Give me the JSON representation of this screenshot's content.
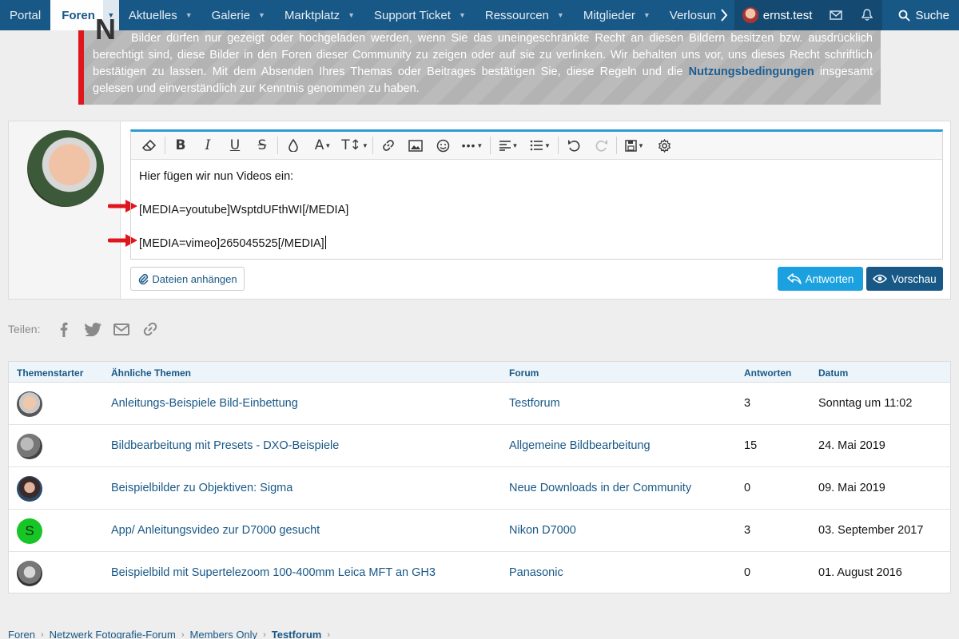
{
  "nav": {
    "items": [
      {
        "label": "Portal"
      },
      {
        "label": "Foren"
      },
      {
        "label": "Aktuelles"
      },
      {
        "label": "Galerie"
      },
      {
        "label": "Marktplatz"
      },
      {
        "label": "Support Ticket"
      },
      {
        "label": "Ressourcen"
      },
      {
        "label": "Mitglieder"
      },
      {
        "label": "Verlosungen"
      }
    ],
    "user": "ernst.test",
    "search": "Suche"
  },
  "notice": {
    "text": "Bilder dürfen nur gezeigt oder hochgeladen werden, wenn Sie das uneingeschränkte Recht an diesen Bildern besitzen bzw. ausdrücklich berechtigt sind, diese Bilder in den Foren dieser Community zu zeigen oder auf sie zu verlinken. Wir behalten uns vor, uns dieses Recht schriftlich bestätigen zu lassen. Mit dem Absenden Ihres Themas oder Beitrages bestätigen Sie, diese Regeln und die ",
    "link": "Nutzungsbedingungen",
    "tail": " insgesamt gelesen und einverständlich zur Kenntnis genommen zu haben."
  },
  "editor": {
    "lines": [
      "Hier fügen wir nun Videos ein:",
      "[MEDIA=youtube]WsptdUFthWI[/MEDIA]",
      "[MEDIA=vimeo]265045525[/MEDIA]"
    ],
    "attach_label": "Dateien anhängen",
    "reply_label": "Antworten",
    "preview_label": "Vorschau"
  },
  "share": {
    "label": "Teilen:"
  },
  "similar": {
    "headers": {
      "starter": "Themenstarter",
      "title": "Ähnliche Themen",
      "forum": "Forum",
      "replies": "Antworten",
      "date": "Datum"
    },
    "rows": [
      {
        "title": "Anleitungs-Beispiele Bild-Einbettung",
        "forum": "Testforum",
        "replies": "3",
        "date": "Sonntag um 11:02",
        "avatar_letter": ""
      },
      {
        "title": "Bildbearbeitung mit Presets - DXO-Beispiele",
        "forum": "Allgemeine Bildbearbeitung",
        "replies": "15",
        "date": "24. Mai 2019",
        "avatar_letter": ""
      },
      {
        "title": "Beispielbilder zu Objektiven: Sigma",
        "forum": "Neue Downloads in der Community",
        "replies": "0",
        "date": "09. Mai 2019",
        "avatar_letter": ""
      },
      {
        "title": "App/ Anleitungsvideo zur D7000 gesucht",
        "forum": "Nikon D7000",
        "replies": "3",
        "date": "03. September 2017",
        "avatar_letter": "S"
      },
      {
        "title": "Beispielbild mit Supertelezoom 100-400mm Leica MFT an GH3",
        "forum": "Panasonic",
        "replies": "0",
        "date": "01. August 2016",
        "avatar_letter": ""
      }
    ]
  },
  "breadcrumb": [
    "Foren",
    "Netzwerk Fotografie-Forum",
    "Members Only",
    "Testforum"
  ],
  "colors": {
    "nav": "#185886",
    "accent": "#1ba1df",
    "notice_border": "#e0161d"
  }
}
